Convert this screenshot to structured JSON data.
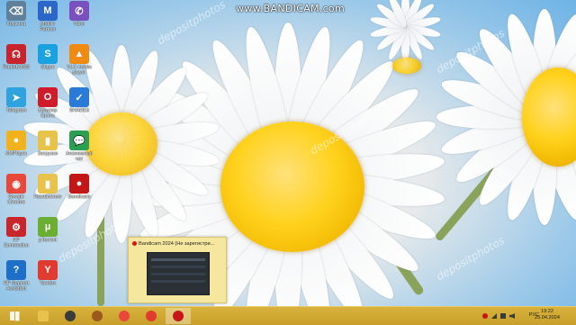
{
  "watermark": {
    "bandicam": "www.BANDICAM.com",
    "depositphotos": "depositphotos"
  },
  "desktop_icons": [
    {
      "label": "Корзина",
      "icon": "recycle-bin-icon",
      "color": "#5f7f9a",
      "glyph": "⌫"
    },
    {
      "label": "Mobile Partner",
      "icon": "mobile-partner-icon",
      "color": "#2a67c8",
      "glyph": "M"
    },
    {
      "label": "Viber",
      "icon": "viber-icon",
      "color": "#7a4fbe",
      "glyph": "✆"
    },
    {
      "label": "RadioBOSS",
      "icon": "radioboss-icon",
      "color": "#c9232e",
      "glyph": "☊"
    },
    {
      "label": "Skype",
      "icon": "skype-icon",
      "color": "#1aa1e0",
      "glyph": "S"
    },
    {
      "label": "VLC media player",
      "icon": "vlc-icon",
      "color": "#f08a12",
      "glyph": "▲"
    },
    {
      "label": "Telegram",
      "icon": "telegram-icon",
      "color": "#2fa3de",
      "glyph": "➤"
    },
    {
      "label": "Браузер Opera",
      "icon": "opera-icon",
      "color": "#cf1c2a",
      "glyph": "O"
    },
    {
      "label": "SHAREit",
      "icon": "shareit-icon",
      "color": "#2a7ad8",
      "glyph": "✓"
    },
    {
      "label": "KMPlayer",
      "icon": "kmplayer-icon",
      "color": "#f2b21c",
      "glyph": "●"
    },
    {
      "label": "Загрузки",
      "icon": "downloads-folder-icon",
      "color": "#e7c34a",
      "glyph": "▮"
    },
    {
      "label": "Анонимный чат",
      "icon": "anonymous-chat-icon",
      "color": "#2ba052",
      "glyph": "💬"
    },
    {
      "label": "Google Chrome",
      "icon": "chrome-icon",
      "color": "#e7483a",
      "glyph": "◉"
    },
    {
      "label": "Назначение",
      "icon": "folder-icon",
      "color": "#e8c24b",
      "glyph": "▮"
    },
    {
      "label": "Bandicam",
      "icon": "bandicam-icon",
      "color": "#c41616",
      "glyph": "●"
    },
    {
      "label": "HP Connection",
      "icon": "hp-connection-icon",
      "color": "#c8262b",
      "glyph": "⚙"
    },
    {
      "label": "µTorrent",
      "icon": "utorrent-icon",
      "color": "#6cae32",
      "glyph": "µ"
    },
    {
      "label": "HP Support Assistant",
      "icon": "hp-support-icon",
      "color": "#1d6fc8",
      "glyph": "?"
    },
    {
      "label": "Yandex",
      "icon": "yandex-icon",
      "color": "#e03b2e",
      "glyph": "Y"
    }
  ],
  "preview": {
    "title": "Bandicam 2024 (Не зарегистри..."
  },
  "taskbar": {
    "items": [
      {
        "name": "file-explorer-icon",
        "color": "#e9c24e"
      },
      {
        "name": "kmplayer-taskbar-icon",
        "color": "#3b3b3b"
      },
      {
        "name": "media-player-taskbar-icon",
        "color": "#9b5a1c"
      },
      {
        "name": "chrome-taskbar-icon",
        "color": "#e7483a"
      },
      {
        "name": "yandex-taskbar-icon",
        "color": "#e03b2e"
      },
      {
        "name": "bandicam-taskbar-icon",
        "color": "#c41616"
      }
    ],
    "lang": "РУС",
    "time": "19:22",
    "date": "25.04.2024"
  }
}
